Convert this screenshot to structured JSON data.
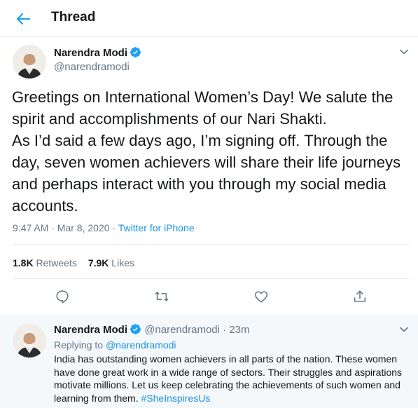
{
  "header": {
    "title": "Thread",
    "back_icon": "arrow-left-icon",
    "accent": "#1da1f2"
  },
  "main_tweet": {
    "author_name": "Narendra Modi",
    "handle": "@narendramodi",
    "verified_icon": "verified-badge-icon",
    "text": "Greetings on International Women’s Day! We salute the spirit and accomplishments of our Nari Shakti.\nAs I’d said a few days ago, I’m signing off. Through the day, seven women achievers will share their life journeys and perhaps interact with you through my social media accounts.",
    "time": "9:47 AM · Mar 8, 2020 · ",
    "source": "Twitter for iPhone",
    "retweets_count": "1.8K",
    "retweets_label": "Retweets",
    "likes_count": "7.9K",
    "likes_label": "Likes",
    "actions": [
      "reply-icon",
      "retweet-icon",
      "like-icon",
      "share-icon"
    ]
  },
  "reply_tweet": {
    "author_name": "Narendra Modi",
    "handle_time": "@narendramodi · 23m",
    "replying_prefix": "Replying to ",
    "replying_handle": "@narendramodi",
    "text": "India has outstanding women achievers in all parts of the nation. These women have done great work in a wide range of sectors. Their struggles and aspirations motivate millions. Let us keep celebrating the achievements of such women and learning from them. ",
    "hashtag": "#SheInspiresUs"
  },
  "colors": {
    "link": "#1b95e0",
    "muted": "#657786",
    "text": "#14171a",
    "border": "#e6ecf0",
    "reply_bg": "#f5f8fa"
  }
}
